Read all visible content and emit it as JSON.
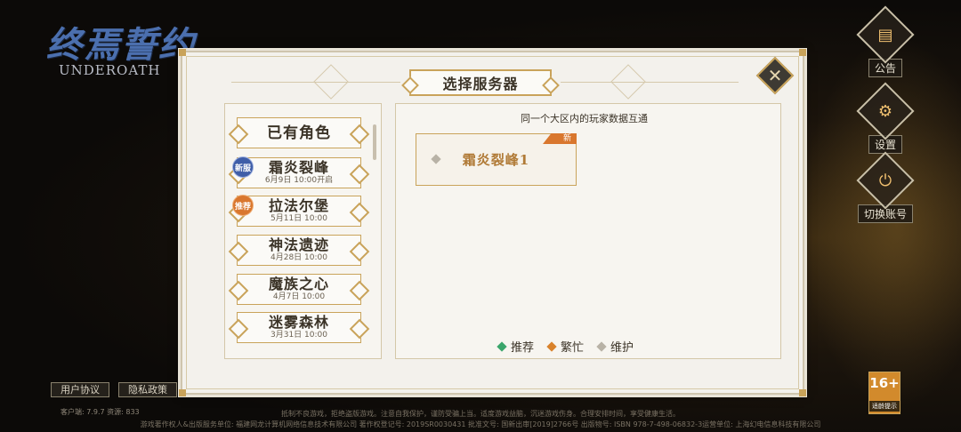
{
  "logo": {
    "title": "终焉誓约",
    "subtitle": "UNDEROATH"
  },
  "side_buttons": [
    {
      "label": "公告",
      "icon": "notice-icon"
    },
    {
      "label": "设置",
      "icon": "settings-icon"
    },
    {
      "label": "切换账号",
      "icon": "switch-account-icon"
    }
  ],
  "dialog": {
    "title": "选择服务器",
    "close_icon": "close-icon"
  },
  "regions": [
    {
      "name": "已有角色",
      "date": "",
      "badge": ""
    },
    {
      "name": "霜炎裂峰",
      "date": "6月9日 10:00开启",
      "badge": "新服"
    },
    {
      "name": "拉法尔堡",
      "date": "5月11日 10:00",
      "badge": "推荐"
    },
    {
      "name": "神法遗迹",
      "date": "4月28日 10:00",
      "badge": ""
    },
    {
      "name": "魔族之心",
      "date": "4月7日 10:00",
      "badge": ""
    },
    {
      "name": "迷雾森林",
      "date": "3月31日 10:00",
      "badge": ""
    }
  ],
  "server_panel": {
    "note": "同一个大区内的玩家数据互通",
    "servers": [
      {
        "name": "霜炎裂峰1",
        "tag": "新"
      }
    ]
  },
  "legend": [
    {
      "label": "推荐",
      "color": "#3aa56b"
    },
    {
      "label": "繁忙",
      "color": "#d9822b"
    },
    {
      "label": "维护",
      "color": "#b8b2a6"
    }
  ],
  "footer": {
    "user_agreement": "用户协议",
    "privacy_policy": "隐私政策",
    "version": "客户端: 7.9.7  资源: 833",
    "disclaimer_line1": "抵制不良游戏，拒绝盗版游戏。注意自我保护，谨防受骗上当。适度游戏益脑，沉迷游戏伤身。合理安排时间，享受健康生活。",
    "disclaimer_line2": "游戏著作权人&出版服务单位: 福建网龙计算机网络信息技术有限公司  著作权登记号: 2019SR0030431  批准文号: 国新出审[2019]2766号  出版物号: ISBN 978-7-498-06832-3运营单位: 上海幻电信息科技有限公司",
    "age_rating": "16+",
    "age_hint": "适龄提示"
  }
}
